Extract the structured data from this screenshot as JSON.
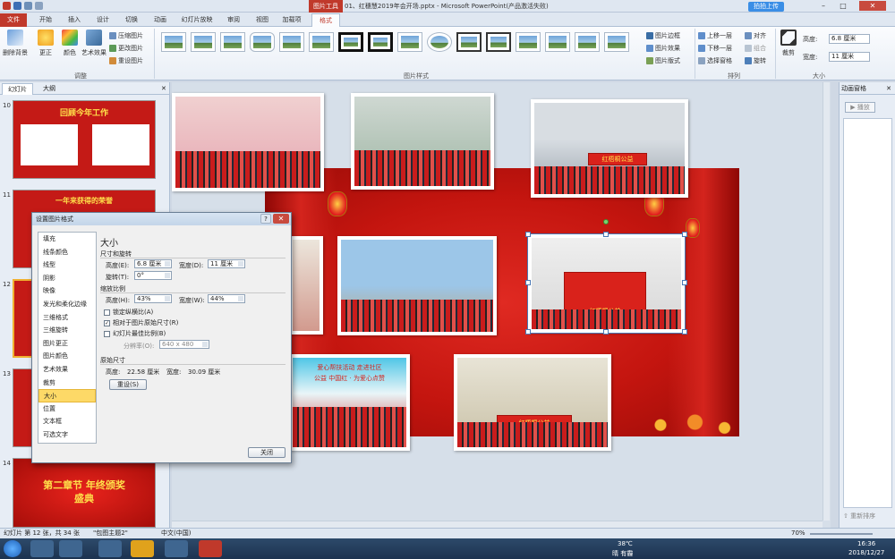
{
  "window": {
    "title": "01、红穗慧2019年会开场.pptx - Microsoft PowerPoint(产品激活失败)",
    "context_tab": "图片工具",
    "cloud_label": "拍拍上传",
    "minimize": "–",
    "maximize": "□",
    "close": "✕"
  },
  "tabs": [
    "文件",
    "开始",
    "插入",
    "设计",
    "切换",
    "动画",
    "幻灯片放映",
    "审阅",
    "视图",
    "加载项",
    "格式"
  ],
  "ribbon": {
    "remove_bg": "删除背景",
    "corrections": "更正",
    "color": "颜色",
    "artistic": "艺术效果",
    "compress": "压缩图片",
    "change": "更改图片",
    "reset": "重设图片",
    "group_adjust": "调整",
    "group_styles": "图片样式",
    "border": "图片边框",
    "effects": "图片效果",
    "layout": "图片版式",
    "bring_forward": "上移一层",
    "send_backward": "下移一层",
    "selection_pane": "选择窗格",
    "align": "对齐",
    "group": "组合",
    "rotate": "旋转",
    "group_arrange": "排列",
    "crop": "裁剪",
    "height_label": "高度:",
    "height_value": "6.8 厘米",
    "width_label": "宽度:",
    "width_value": "11 厘米",
    "group_size": "大小"
  },
  "left_pane": {
    "tab_slides": "幻灯片",
    "tab_outline": "大纲",
    "slides": [
      {
        "num": "10",
        "title": "回顾今年工作"
      },
      {
        "num": "11",
        "title": "一年来获得的荣誉"
      },
      {
        "num": "12",
        "title": ""
      },
      {
        "num": "13",
        "title": ""
      },
      {
        "num": "14",
        "title": "第二章节 年终颁奖盛典"
      }
    ]
  },
  "slide": {
    "banner1": "红梧桐公益",
    "banner2": "红梧桐公益",
    "banner3": "红梧桐公益",
    "caption_top": "爱心帮扶活动 走进社区",
    "caption_bottom": "公益 中国红 · 为爱心点赞"
  },
  "dialog": {
    "title": "设置图片格式",
    "help": "?",
    "categories": [
      "填充",
      "线条颜色",
      "线型",
      "阴影",
      "映像",
      "发光和柔化边缘",
      "三维格式",
      "三维旋转",
      "图片更正",
      "图片颜色",
      "艺术效果",
      "裁剪",
      "大小",
      "位置",
      "文本框",
      "可选文字"
    ],
    "selected_category": "大小",
    "heading": "大小",
    "section_size": "尺寸和旋转",
    "height_label": "高度(E):",
    "height_value": "6.8 厘米",
    "width_label": "宽度(D):",
    "width_value": "11 厘米",
    "rotate_label": "旋转(T):",
    "rotate_value": "0°",
    "section_scale": "缩放比例",
    "scale_h_label": "高度(H):",
    "scale_h_value": "43%",
    "scale_w_label": "宽度(W):",
    "scale_w_value": "44%",
    "lock_aspect": "锁定纵横比(A)",
    "relative": "相对于图片原始尺寸(R)",
    "best_scale": "幻灯片最佳比例(B)",
    "resolution_label": "分辨率(O):",
    "resolution_value": "640 x 480",
    "section_original": "原始尺寸",
    "orig_h_label": "高度:",
    "orig_h_value": "22.58 厘米",
    "orig_w_label": "宽度:",
    "orig_w_value": "30.09 厘米",
    "reset_btn": "重设(S)",
    "close_btn": "关闭"
  },
  "right_pane": {
    "title": "动画窗格",
    "play": "播放",
    "reorder": "重新排序"
  },
  "statusbar": {
    "slide_info": "幻灯片 第 12 张，共 34 张",
    "theme": "\"包图主题2\"",
    "language": "中文(中国)",
    "zoom": "70%"
  },
  "taskbar": {
    "weather_temp": "38℃",
    "weather_desc": "晴 有霾",
    "time": "16:36",
    "date": "2018/12/27"
  },
  "colors": {
    "accent": "#c0392b",
    "dialog_select": "#fdd967"
  }
}
